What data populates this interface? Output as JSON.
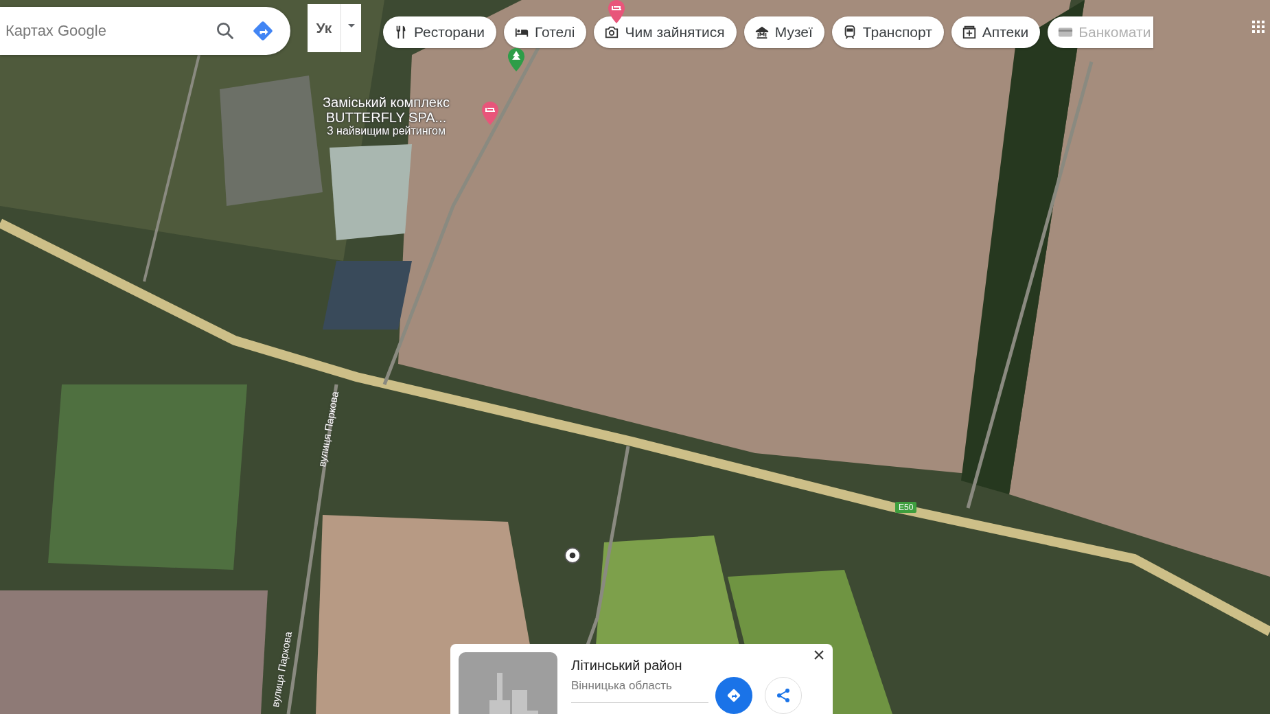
{
  "search": {
    "placeholder": "Картах Google"
  },
  "layers": {
    "label": "Ук"
  },
  "chips": [
    {
      "label": "Ресторани",
      "kind": "restaurant",
      "disabled": false
    },
    {
      "label": "Готелі",
      "kind": "hotel",
      "disabled": false
    },
    {
      "label": "Чим зайнятися",
      "kind": "camera",
      "disabled": false
    },
    {
      "label": "Музеї",
      "kind": "museum",
      "disabled": false
    },
    {
      "label": "Транспорт",
      "kind": "train",
      "disabled": false
    },
    {
      "label": "Аптеки",
      "kind": "pharmacy",
      "disabled": false
    },
    {
      "label": "Банкомати",
      "kind": "atm",
      "disabled": true
    }
  ],
  "map": {
    "places": [
      {
        "name": [
          "Заміський комплекс",
          "BUTTERFLY SPA..."
        ],
        "note": "З найвищим рейтингом",
        "kind": "hotel"
      }
    ],
    "pins": [
      {
        "kind": "park"
      },
      {
        "kind": "hotel"
      }
    ],
    "streets": [
      {
        "label": "вулиця Паркова"
      },
      {
        "label": "вулиця Паркова"
      }
    ],
    "road_shields": [
      {
        "label": "E50"
      }
    ]
  },
  "place_card": {
    "title": "Літинський район",
    "subtitle": "Вінницька область"
  }
}
